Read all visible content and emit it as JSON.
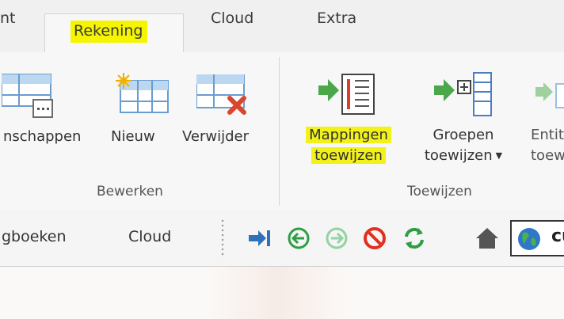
{
  "tabs": {
    "partial": "nt",
    "rekening": "Rekening",
    "cloud": "Cloud",
    "extra": "Extra"
  },
  "ribbon": {
    "eigenschappen": "nschappen",
    "nieuw": "Nieuw",
    "verwijder": "Verwijder",
    "group_bewerken": "Bewerken",
    "mappingen_line1": "Mappingen",
    "mappingen_line2": "toewijzen",
    "groepen_line1": "Groepen",
    "groepen_line2": "toewijzen",
    "entiteit_line1": "Entit",
    "entiteit_line2": "toew",
    "group_toewijzen": "Toewijzen"
  },
  "toolbar": {
    "logboeken": "gboeken",
    "cloud": "Cloud",
    "url_partial": "cu"
  },
  "colors": {
    "highlight": "#f5f500",
    "green": "#2e9e44",
    "red": "#e03020",
    "blue": "#3a7fc1"
  }
}
